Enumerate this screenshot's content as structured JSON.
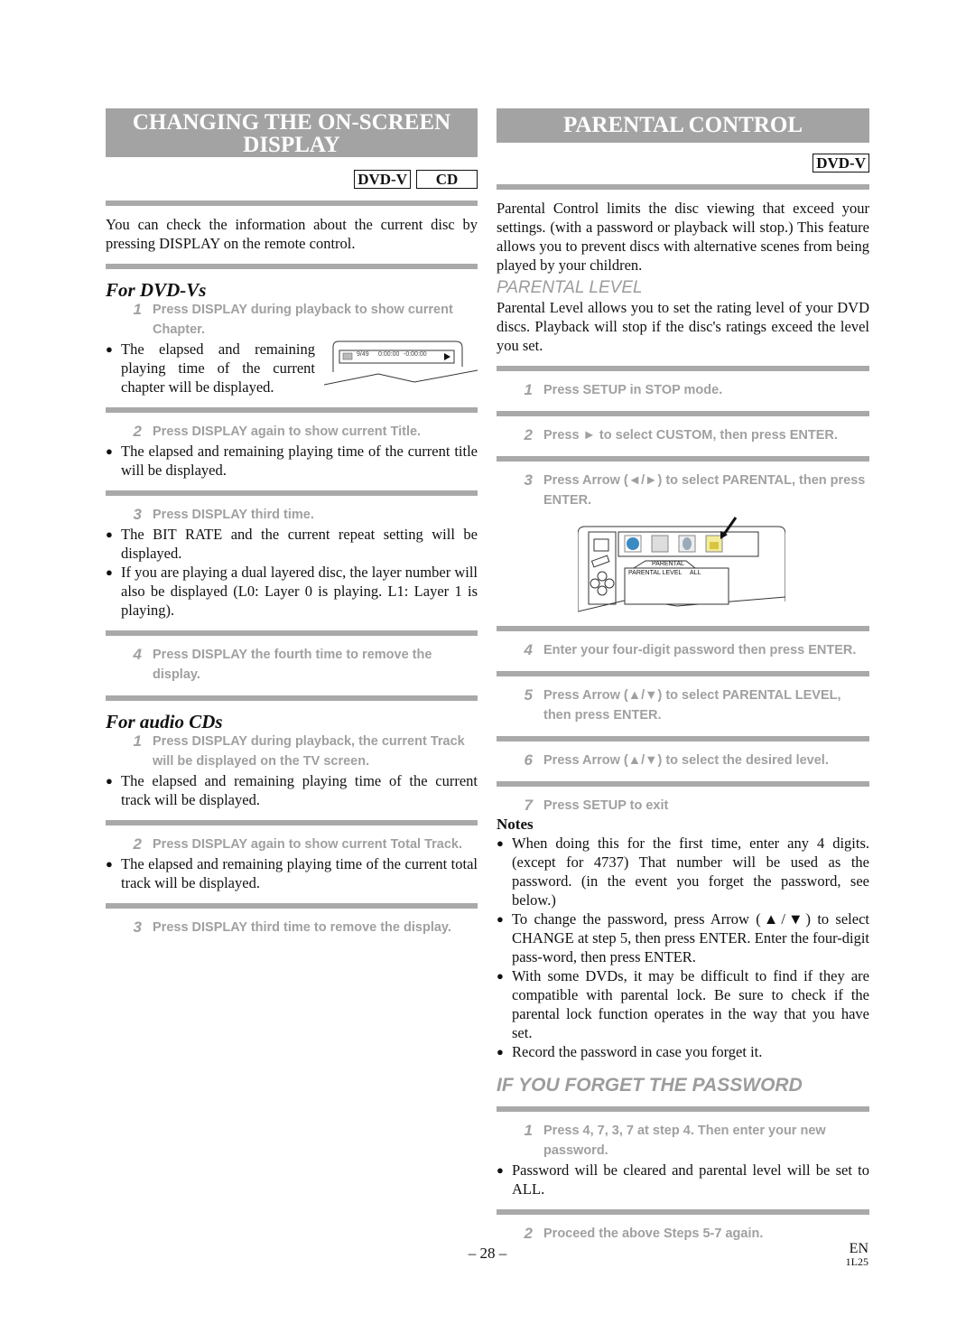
{
  "left": {
    "title": "Changing the On-Screen Display",
    "badges": [
      "DVD-V",
      "CD"
    ],
    "intro": "You can check the information about the current disc by pressing DISPLAY on the remote control.",
    "dvd": {
      "heading": "For DVD-Vs",
      "steps": [
        {
          "num": "1",
          "text": "Press DISPLAY during playback to show current Chapter.",
          "bullets": [
            "The elapsed and remaining playing time of the current chapter will be displayed."
          ]
        },
        {
          "num": "2",
          "text": "Press DISPLAY again to show current Title.",
          "bullets": [
            "The elapsed and remaining playing time of the current title will be displayed."
          ]
        },
        {
          "num": "3",
          "text": "Press DISPLAY third time.",
          "bullets": [
            "The BIT RATE and the current repeat setting will be displayed.",
            "If you are playing a dual layered disc, the layer number will also be displayed (L0: Layer 0 is playing. L1: Layer 1 is playing)."
          ]
        },
        {
          "num": "4",
          "text": "Press DISPLAY the fourth time to remove the display.",
          "bullets": []
        }
      ],
      "osd": {
        "chapter": "9/49",
        "elapsed": "0:00:00",
        "remaining": "-0:00:00",
        "play_icon": "play-icon"
      }
    },
    "cd": {
      "heading": "For audio CDs",
      "steps": [
        {
          "num": "1",
          "text": "Press DISPLAY during playback, the current Track will be displayed on the TV screen.",
          "bullets": [
            "The elapsed and remaining playing time of the current track will be displayed."
          ]
        },
        {
          "num": "2",
          "text": "Press DISPLAY again to show current Total Track.",
          "bullets": [
            "The elapsed and remaining playing time of the current total track will be displayed."
          ]
        },
        {
          "num": "3",
          "text": "Press DISPLAY third time to remove the display.",
          "bullets": []
        }
      ]
    }
  },
  "right": {
    "title": "Parental Control",
    "badges": [
      "DVD-V"
    ],
    "intro": "Parental Control limits the disc viewing that exceed your settings. (with a password or playback will stop.) This feature allows you to prevent discs with alternative scenes from being played by your children.",
    "level_heading": "PARENTAL LEVEL",
    "level_intro": "Parental Level allows you to set the rating level of your DVD discs. Playback will stop if the disc's ratings exceed the level you set.",
    "steps": [
      {
        "num": "1",
        "text": "Press SETUP in STOP mode."
      },
      {
        "num": "2",
        "text": "Press ► to select CUSTOM, then press ENTER."
      },
      {
        "num": "3",
        "text": "Press Arrow (◄/►) to select PARENTAL, then press ENTER."
      },
      {
        "num": "4",
        "text": "Enter your four-digit password then press ENTER."
      },
      {
        "num": "5",
        "text": "Press Arrow (▲/▼) to select PARENTAL LEVEL, then press ENTER."
      },
      {
        "num": "6",
        "text": "Press Arrow (▲/▼) to select the desired level."
      },
      {
        "num": "7",
        "text": "Press SETUP to exit"
      }
    ],
    "menu": {
      "tab": "PARENTAL",
      "row_label": "PARENTAL LEVEL",
      "row_value": "ALL"
    },
    "notes_heading": "Notes",
    "notes": [
      "When doing this for the first time, enter any 4 digits. (except for 4737) That number will be used as the password. (in the event you forget the password, see below.)",
      "To change the password, press Arrow (▲/▼) to select CHANGE at step 5, then press ENTER. Enter the four-digit pass-word, then press ENTER.",
      "With some DVDs, it may be difficult to find if they are compatible with parental lock. Be sure to check if the parental lock function operates in the way that you have set.",
      "Record the password in case you forget it."
    ],
    "forget_heading": "IF YOU FORGET THE PASSWORD",
    "forget_steps": [
      {
        "num": "1",
        "text": "Press 4, 7, 3, 7 at step 4. Then enter your new password.",
        "bullets": [
          "Password will be cleared and parental level will be set to ALL."
        ]
      },
      {
        "num": "2",
        "text": "Proceed the above Steps 5-7 again.",
        "bullets": []
      }
    ]
  },
  "footer": {
    "page": "– 28 –",
    "lang": "EN",
    "code": "1L25"
  },
  "colors": {
    "banner": "#a3a3a3",
    "step_text": "#a0a0a0",
    "rule": "#a9a9a9"
  }
}
